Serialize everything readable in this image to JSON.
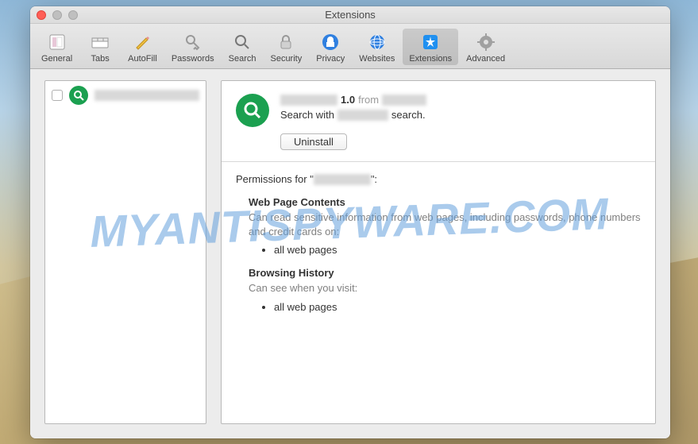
{
  "window_title": "Extensions",
  "watermark": "MYANTISPYWARE.COM",
  "toolbar": [
    {
      "id": "general",
      "label": "General"
    },
    {
      "id": "tabs",
      "label": "Tabs"
    },
    {
      "id": "autofill",
      "label": "AutoFill"
    },
    {
      "id": "passwords",
      "label": "Passwords"
    },
    {
      "id": "search",
      "label": "Search"
    },
    {
      "id": "security",
      "label": "Security"
    },
    {
      "id": "privacy",
      "label": "Privacy"
    },
    {
      "id": "websites",
      "label": "Websites"
    },
    {
      "id": "extensions",
      "label": "Extensions",
      "active": true
    },
    {
      "id": "advanced",
      "label": "Advanced"
    }
  ],
  "sidebar": {
    "items": [
      {
        "name_redacted": true
      }
    ]
  },
  "extension": {
    "name_redacted": true,
    "version": "1.0",
    "from_label": "from",
    "developer_redacted": true,
    "desc_prefix": "Search with",
    "desc_mid_redacted": true,
    "desc_suffix": "search.",
    "uninstall_label": "Uninstall"
  },
  "permissions": {
    "for_prefix": "Permissions for \"",
    "for_name_redacted": true,
    "for_suffix": "\":",
    "sections": [
      {
        "heading": "Web Page Contents",
        "desc": "Can read sensitive information from web pages, including passwords, phone numbers and credit cards on:",
        "items": [
          "all web pages"
        ]
      },
      {
        "heading": "Browsing History",
        "desc": "Can see when you visit:",
        "items": [
          "all web pages"
        ]
      }
    ]
  }
}
